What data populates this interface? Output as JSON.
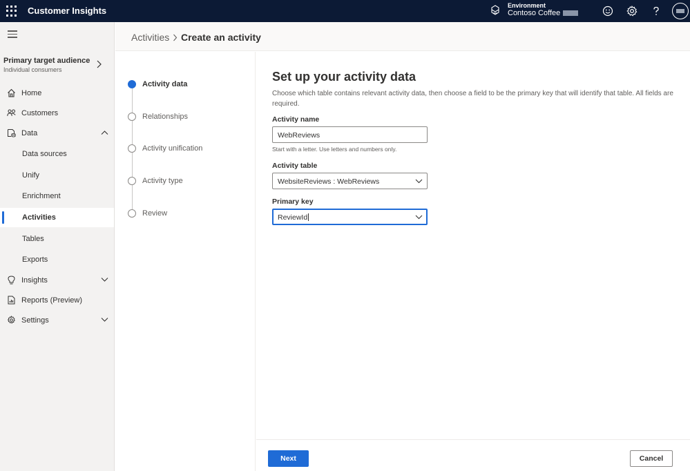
{
  "topbar": {
    "app_title": "Customer Insights",
    "environment_label": "Environment",
    "environment_name": "Contoso Coffee",
    "icons": [
      "waffle-icon",
      "environment-icon",
      "feedback-smiley-icon",
      "gear-icon",
      "help-icon",
      "avatar"
    ]
  },
  "leftnav": {
    "audience_title": "Primary target audience",
    "audience_subtitle": "Individual consumers",
    "items": [
      {
        "label": "Home",
        "icon": "home-icon"
      },
      {
        "label": "Customers",
        "icon": "people-icon"
      },
      {
        "label": "Data",
        "icon": "data-icon",
        "expanded": true
      },
      {
        "label": "Data sources"
      },
      {
        "label": "Unify"
      },
      {
        "label": "Enrichment"
      },
      {
        "label": "Activities",
        "selected": true
      },
      {
        "label": "Tables"
      },
      {
        "label": "Exports"
      },
      {
        "label": "Insights",
        "icon": "lightbulb-icon",
        "expanded": false
      },
      {
        "label": "Reports (Preview)",
        "icon": "report-icon"
      },
      {
        "label": "Settings",
        "icon": "gear-icon",
        "expanded": false
      }
    ]
  },
  "breadcrumb": {
    "parent": "Activities",
    "current": "Create an activity"
  },
  "steps": [
    {
      "label": "Activity data",
      "active": true
    },
    {
      "label": "Relationships"
    },
    {
      "label": "Activity unification"
    },
    {
      "label": "Activity type"
    },
    {
      "label": "Review"
    }
  ],
  "form": {
    "title": "Set up your activity data",
    "description": "Choose which table contains relevant activity data, then choose a field to be the primary key that will identify that table. All fields are required.",
    "activity_name_label": "Activity name",
    "activity_name_value": "WebReviews",
    "activity_name_hint": "Start with a letter. Use letters and numbers only.",
    "activity_table_label": "Activity table",
    "activity_table_value": "WebsiteReviews : WebReviews",
    "primary_key_label": "Primary key",
    "primary_key_value": "ReviewId"
  },
  "footer": {
    "next_label": "Next",
    "cancel_label": "Cancel"
  },
  "colors": {
    "topbar_bg": "#0c1a35",
    "accent": "#1f6bd6",
    "nav_bg": "#f3f2f1"
  }
}
